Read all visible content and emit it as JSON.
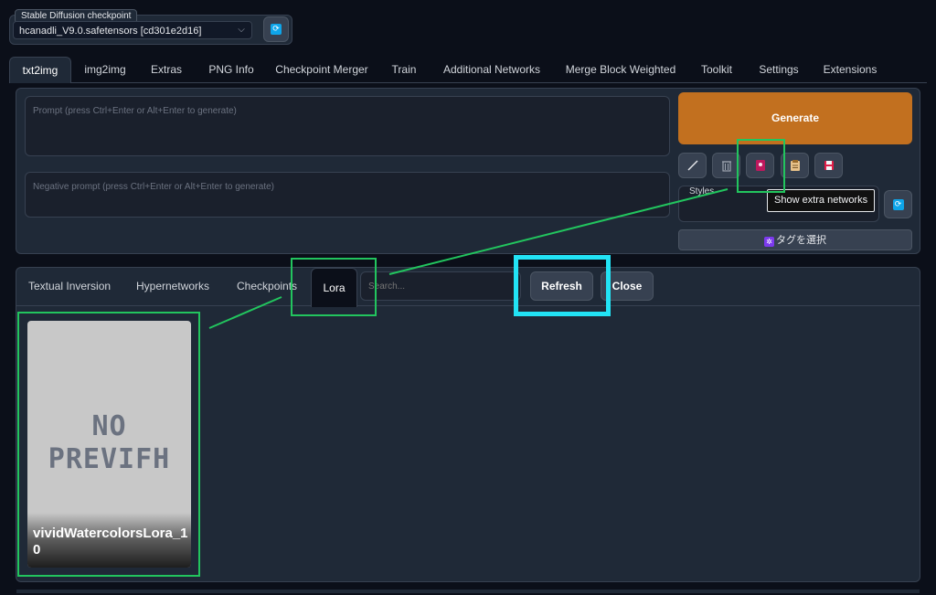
{
  "checkpoint": {
    "label": "Stable Diffusion checkpoint",
    "value": "hcanadli_V9.0.safetensors [cd301e2d16]",
    "chevron": "⌵"
  },
  "tabs": [
    "txt2img",
    "img2img",
    "Extras",
    "PNG Info",
    "Checkpoint Merger",
    "Train",
    "Additional Networks",
    "Merge Block Weighted",
    "Toolkit",
    "Settings",
    "Extensions"
  ],
  "prompt": {
    "placeholder": "Prompt (press Ctrl+Enter or Alt+Enter to generate)",
    "negative_placeholder": "Negative prompt (press Ctrl+Enter or Alt+Enter to generate)"
  },
  "toolbar": {
    "generate": "Generate",
    "styles_label": "Styles",
    "tooltip": "Show extra networks",
    "tag_select": "タグを選択",
    "icons": [
      "pencil-icon",
      "trash-icon",
      "extra-networks-icon",
      "clipboard-icon",
      "save-icon"
    ]
  },
  "extra_networks": {
    "tabs": [
      "Textual Inversion",
      "Hypernetworks",
      "Checkpoints",
      "Lora"
    ],
    "search_placeholder": "Search...",
    "refresh": "Refresh",
    "close": "Close",
    "card": {
      "name": "vividWatercolorsLora_10",
      "preview_line1": "NO",
      "preview_line2": "PREVIFH"
    }
  },
  "colors": {
    "background": "#0b0f19",
    "panel": "#1f2937",
    "generate": "#c2701f",
    "annotation_green": "#22c55e",
    "annotation_cyan": "#22e3f5"
  }
}
